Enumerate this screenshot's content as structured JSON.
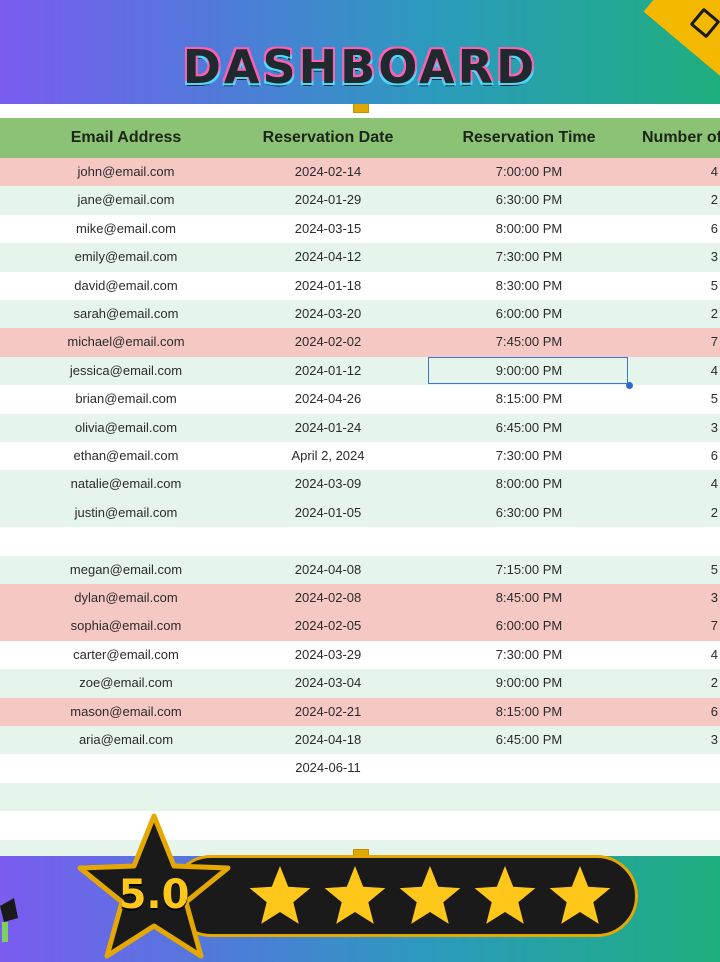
{
  "header": {
    "title": "DASHBOARD"
  },
  "table": {
    "columns": [
      "Email Address",
      "Reservation Date",
      "Reservation Time",
      "Number of"
    ],
    "rows": [
      {
        "email": "john@email.com",
        "date": "2024-02-14",
        "time": "7:00:00 PM",
        "guests": "4",
        "style": "red"
      },
      {
        "email": "jane@email.com",
        "date": "2024-01-29",
        "time": "6:30:00 PM",
        "guests": "2",
        "style": "green"
      },
      {
        "email": "mike@email.com",
        "date": "2024-03-15",
        "time": "8:00:00 PM",
        "guests": "6",
        "style": "white"
      },
      {
        "email": "emily@email.com",
        "date": "2024-04-12",
        "time": "7:30:00 PM",
        "guests": "3",
        "style": "green"
      },
      {
        "email": "david@email.com",
        "date": "2024-01-18",
        "time": "8:30:00 PM",
        "guests": "5",
        "style": "white"
      },
      {
        "email": "sarah@email.com",
        "date": "2024-03-20",
        "time": "6:00:00 PM",
        "guests": "2",
        "style": "green"
      },
      {
        "email": "michael@email.com",
        "date": "2024-02-02",
        "time": "7:45:00 PM",
        "guests": "7",
        "style": "red"
      },
      {
        "email": "jessica@email.com",
        "date": "2024-01-12",
        "time": "9:00:00 PM",
        "guests": "4",
        "style": "green"
      },
      {
        "email": "brian@email.com",
        "date": "2024-04-26",
        "time": "8:15:00 PM",
        "guests": "5",
        "style": "white"
      },
      {
        "email": "olivia@email.com",
        "date": "2024-01-24",
        "time": "6:45:00 PM",
        "guests": "3",
        "style": "green"
      },
      {
        "email": "ethan@email.com",
        "date": "April 2, 2024",
        "time": "7:30:00 PM",
        "guests": "6",
        "style": "white"
      },
      {
        "email": "natalie@email.com",
        "date": "2024-03-09",
        "time": "8:00:00 PM",
        "guests": "4",
        "style": "green"
      },
      {
        "email": "justin@email.com",
        "date": "2024-01-05",
        "time": "6:30:00 PM",
        "guests": "2",
        "style": "green"
      },
      {
        "email": "",
        "date": "",
        "time": "",
        "guests": "",
        "style": "white"
      },
      {
        "email": "megan@email.com",
        "date": "2024-04-08",
        "time": "7:15:00 PM",
        "guests": "5",
        "style": "green"
      },
      {
        "email": "dylan@email.com",
        "date": "2024-02-08",
        "time": "8:45:00 PM",
        "guests": "3",
        "style": "red"
      },
      {
        "email": "sophia@email.com",
        "date": "2024-02-05",
        "time": "6:00:00 PM",
        "guests": "7",
        "style": "red"
      },
      {
        "email": "carter@email.com",
        "date": "2024-03-29",
        "time": "7:30:00 PM",
        "guests": "4",
        "style": "white"
      },
      {
        "email": "zoe@email.com",
        "date": "2024-03-04",
        "time": "9:00:00 PM",
        "guests": "2",
        "style": "green"
      },
      {
        "email": "mason@email.com",
        "date": "2024-02-21",
        "time": "8:15:00 PM",
        "guests": "6",
        "style": "red"
      },
      {
        "email": "aria@email.com",
        "date": "2024-04-18",
        "time": "6:45:00 PM",
        "guests": "3",
        "style": "green"
      },
      {
        "email": "",
        "date": "2024-06-11",
        "time": "",
        "guests": "",
        "style": "white"
      },
      {
        "email": "",
        "date": "",
        "time": "",
        "guests": "",
        "style": "green"
      },
      {
        "email": "",
        "date": "",
        "time": "",
        "guests": "",
        "style": "white"
      },
      {
        "email": "",
        "date": "",
        "time": "",
        "guests": "",
        "style": "green"
      }
    ]
  },
  "rating": {
    "value": "5.0",
    "stars": 5
  },
  "colors": {
    "header_green": "#8cc276",
    "row_red": "#f5c8c4",
    "row_green": "#e6f5ec",
    "star_gold": "#ffc71a"
  },
  "icons": [
    "star-icon",
    "corner-tag-icon",
    "selection-handle-icon"
  ]
}
